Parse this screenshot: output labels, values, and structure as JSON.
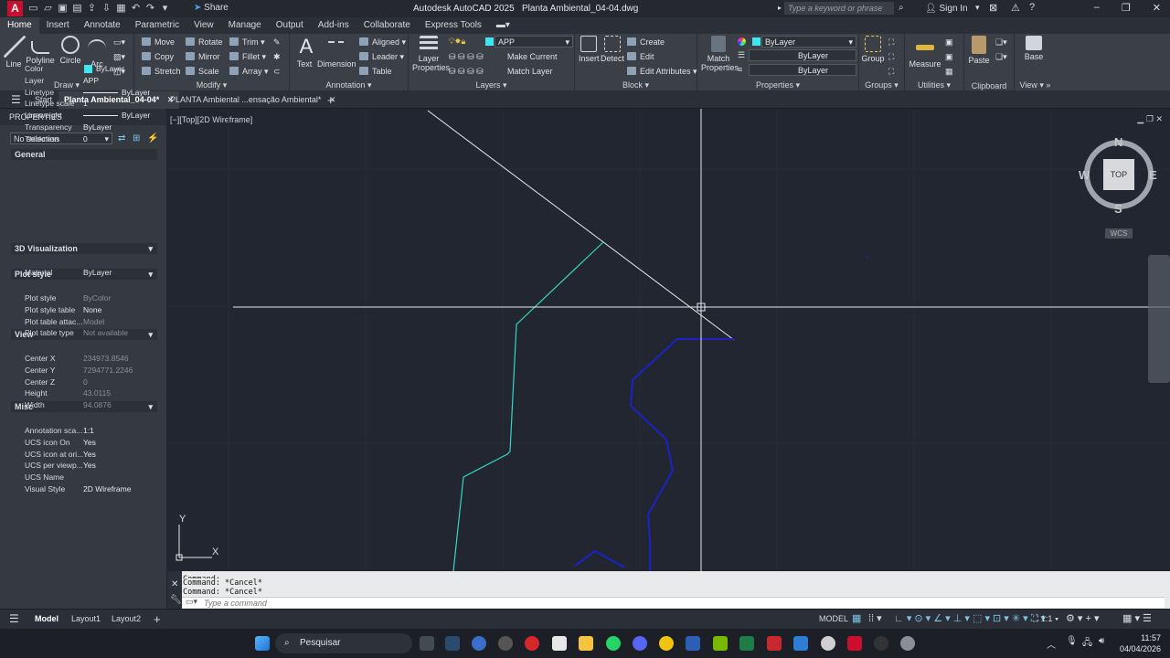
{
  "app": {
    "logo": "A",
    "share": "Share",
    "title": "Autodesk AutoCAD 2025",
    "file": "Planta Ambiental_04-04.dwg",
    "search_placeholder": "Type a keyword or phrase",
    "sign_in": "Sign In"
  },
  "ribbon_tabs": [
    "Home",
    "Insert",
    "Annotate",
    "Parametric",
    "View",
    "Manage",
    "Output",
    "Add-ins",
    "Collaborate",
    "Express Tools"
  ],
  "draw": {
    "title": "Draw",
    "line": "Line",
    "polyline": "Polyline",
    "circle": "Circle",
    "arc": "Arc"
  },
  "modify": {
    "title": "Modify",
    "move": "Move",
    "rotate": "Rotate",
    "trim": "Trim",
    "copy": "Copy",
    "mirror": "Mirror",
    "fillet": "Fillet",
    "stretch": "Stretch",
    "scale": "Scale",
    "array": "Array"
  },
  "annotation": {
    "title": "Annotation",
    "text": "Text",
    "dimension": "Dimension",
    "aligned": "Aligned",
    "leader": "Leader",
    "table": "Table"
  },
  "layers": {
    "title": "Layers",
    "properties": "Layer Properties",
    "current": "APP",
    "make_current": "Make Current",
    "match_layer": "Match Layer"
  },
  "block": {
    "title": "Block",
    "insert": "Insert",
    "detect": "Detect",
    "create": "Create",
    "edit": "Edit",
    "edit_attributes": "Edit Attributes"
  },
  "properties_panel": {
    "title": "Properties",
    "match": "Match Properties",
    "color": "ByLayer",
    "linetype": "ByLayer",
    "lineweight": "ByLayer"
  },
  "groups": {
    "title": "Groups",
    "group": "Group"
  },
  "utilities": {
    "title": "Utilities",
    "measure": "Measure"
  },
  "clipboard": {
    "title": "Clipboard",
    "paste": "Paste"
  },
  "view_panel": {
    "title": "View",
    "base": "Base"
  },
  "doc_tabs": {
    "start": "Start",
    "active": "Planta Ambiental_04-04*",
    "other": "PLANTA Ambiental ...ensação Ambiental*"
  },
  "properties": {
    "header": "PROPERTIES",
    "selection": "No selection",
    "sections": {
      "general": "General",
      "viz": "3D Visualization",
      "plot": "Plot style",
      "view": "View",
      "misc": "Misc"
    },
    "general": [
      {
        "k": "Color",
        "v": "ByLayer"
      },
      {
        "k": "Layer",
        "v": "APP"
      },
      {
        "k": "Linetype",
        "v": "ByLayer"
      },
      {
        "k": "Linetype scale",
        "v": "1"
      },
      {
        "k": "Lineweight",
        "v": "ByLayer"
      },
      {
        "k": "Transparency",
        "v": "ByLayer"
      },
      {
        "k": "Thickness",
        "v": "0"
      }
    ],
    "viz": [
      {
        "k": "Material",
        "v": "ByLayer"
      }
    ],
    "plot": [
      {
        "k": "Plot style",
        "v": "ByColor"
      },
      {
        "k": "Plot style table",
        "v": "None"
      },
      {
        "k": "Plot table attac...",
        "v": "Model"
      },
      {
        "k": "Plot table type",
        "v": "Not available"
      }
    ],
    "view": [
      {
        "k": "Center X",
        "v": "234973.8546"
      },
      {
        "k": "Center Y",
        "v": "7294771.2246"
      },
      {
        "k": "Center Z",
        "v": "0"
      },
      {
        "k": "Height",
        "v": "43.0115"
      },
      {
        "k": "Width",
        "v": "94.0876"
      }
    ],
    "misc": [
      {
        "k": "Annotation sca...",
        "v": "1:1"
      },
      {
        "k": "UCS icon On",
        "v": "Yes"
      },
      {
        "k": "UCS icon at ori...",
        "v": "Yes"
      },
      {
        "k": "UCS per viewp...",
        "v": "Yes"
      },
      {
        "k": "UCS Name",
        "v": ""
      },
      {
        "k": "Visual Style",
        "v": "2D Wireframe"
      }
    ]
  },
  "viewport": {
    "label": "[−][Top][2D Wireframe]",
    "viewcube": {
      "n": "N",
      "s": "S",
      "e": "E",
      "w": "W",
      "top": "TOP",
      "wcs": "WCS"
    },
    "ucs": {
      "x": "X",
      "y": "Y"
    }
  },
  "command": {
    "line0": "Command:",
    "line1": "Command: *Cancel*",
    "line2": "Command: *Cancel*",
    "placeholder": "Type a command"
  },
  "status": {
    "model": "Model",
    "layout1": "Layout1",
    "layout2": "Layout2",
    "mode": "MODEL",
    "scale": "1:1"
  },
  "taskbar": {
    "search": "Pesquisar",
    "time": "11:57",
    "date": "04/04/2026"
  },
  "colors": {
    "accent": "#c8102e",
    "cyan_line": "#35d6c0",
    "blue_line": "#1a22c8",
    "layer_swatch": "#3ee6f0"
  }
}
